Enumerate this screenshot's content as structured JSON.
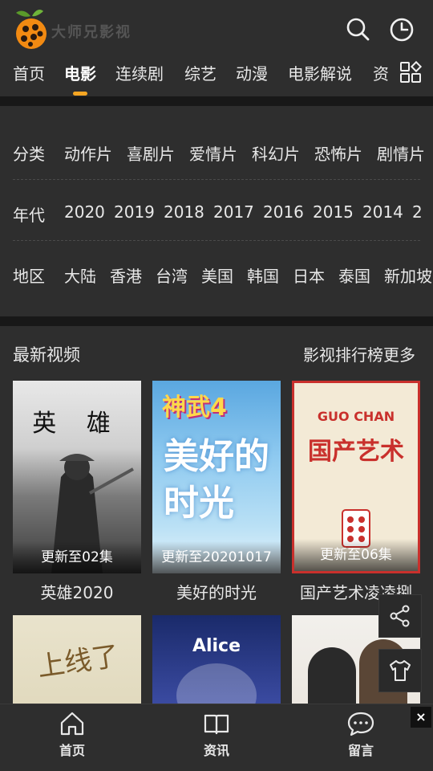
{
  "header": {
    "logo_text": "大师兄影视",
    "search_icon": "search-icon",
    "history_icon": "clock-icon"
  },
  "nav": {
    "tabs": [
      {
        "label": "首页"
      },
      {
        "label": "电影"
      },
      {
        "label": "连续剧"
      },
      {
        "label": "综艺"
      },
      {
        "label": "动漫"
      },
      {
        "label": "电影解说"
      },
      {
        "label": "资"
      }
    ],
    "active_index": 1,
    "grid_icon": "grid-icon",
    "accent_color": "#f5a623"
  },
  "filters": {
    "category": {
      "label": "分类",
      "options": [
        "动作片",
        "喜剧片",
        "爱情片",
        "科幻片",
        "恐怖片",
        "剧情片"
      ]
    },
    "year": {
      "label": "年代",
      "options": [
        "2020",
        "2019",
        "2018",
        "2017",
        "2016",
        "2015",
        "2014",
        "2"
      ]
    },
    "region": {
      "label": "地区",
      "options": [
        "大陆",
        "香港",
        "台湾",
        "美国",
        "韩国",
        "日本",
        "泰国",
        "新加坡"
      ]
    }
  },
  "latest": {
    "title": "最新视频",
    "more": "影视排行榜更多",
    "items": [
      {
        "title": "英雄2020",
        "status": "更新至02集",
        "poster_text": "英 雄"
      },
      {
        "title": "美好的时光",
        "status": "更新至20201017",
        "poster_text": "美好的时光"
      },
      {
        "title": "国产艺术凌凌捌",
        "status": "更新至06集",
        "poster_text": "国产艺术"
      },
      {
        "title": "",
        "status": "",
        "poster_text": "上线了"
      },
      {
        "title": "",
        "status": "",
        "poster_text": "Alice"
      },
      {
        "title": "",
        "status": "",
        "poster_text": ""
      }
    ]
  },
  "float": {
    "share_icon": "share-icon",
    "shirt_icon": "shirt-icon"
  },
  "bottom_nav": {
    "tabs": [
      {
        "label": "首页",
        "icon": "home-icon"
      },
      {
        "label": "资讯",
        "icon": "book-icon"
      },
      {
        "label": "留言",
        "icon": "chat-icon"
      }
    ],
    "close_label": "×"
  }
}
